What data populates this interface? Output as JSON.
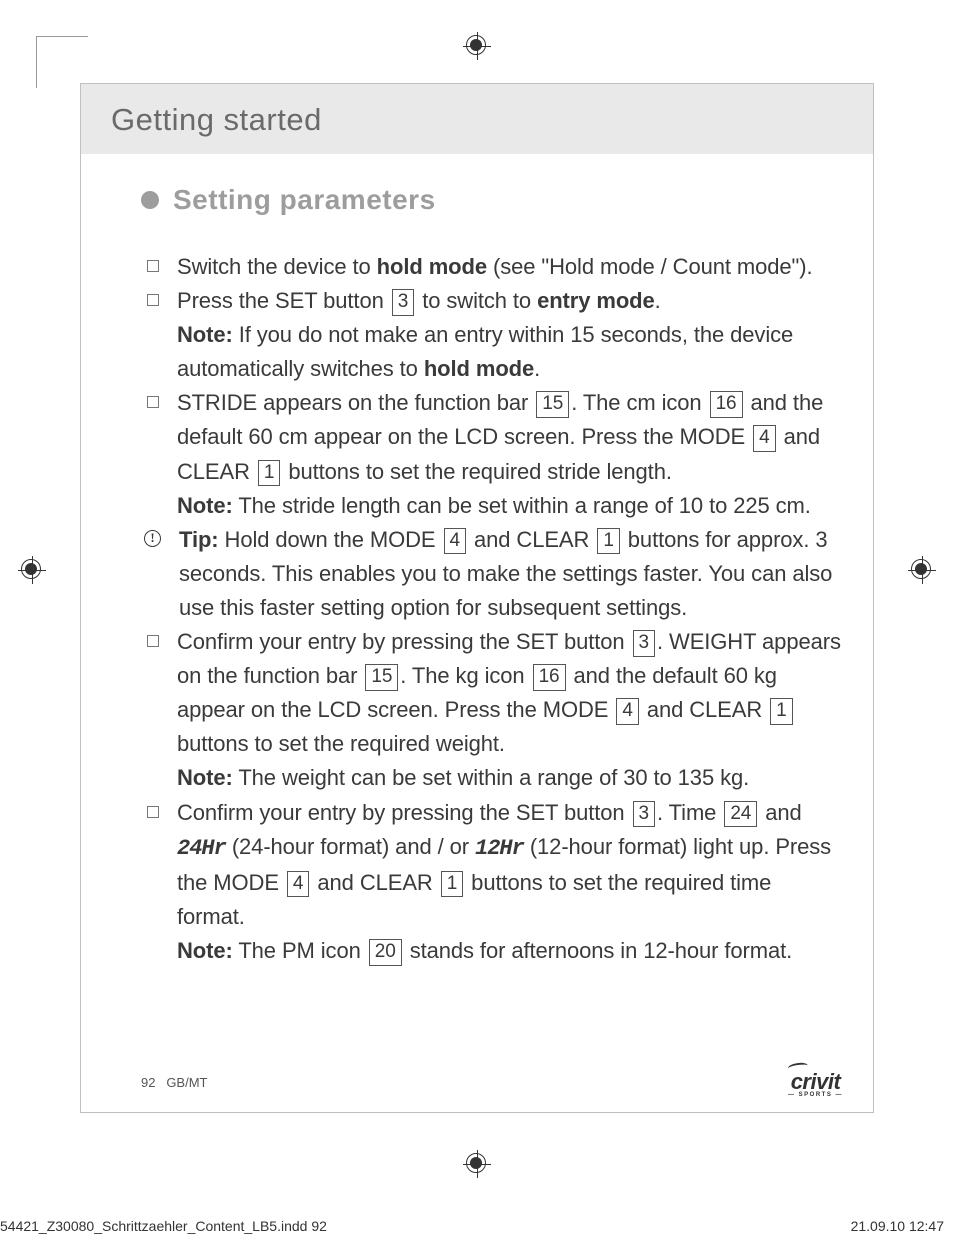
{
  "header": "Getting started",
  "section_title": "Setting parameters",
  "items": [
    {
      "marker": "checkbox",
      "segments": [
        {
          "t": "Switch the device to "
        },
        {
          "t": "hold mode",
          "bold": true
        },
        {
          "t": " (see \"Hold mode / Count mode\")."
        }
      ]
    },
    {
      "marker": "checkbox",
      "segments": [
        {
          "t": "Press the SET button "
        },
        {
          "num": "3"
        },
        {
          "t": " to switch to "
        },
        {
          "t": "entry mode",
          "bold": true
        },
        {
          "t": "."
        },
        {
          "br": true
        },
        {
          "t": "Note:",
          "bold": true
        },
        {
          "t": " If you do not make an entry within 15 seconds, the device automatically switches to "
        },
        {
          "t": "hold mode",
          "bold": true
        },
        {
          "t": "."
        }
      ]
    },
    {
      "marker": "checkbox",
      "segments": [
        {
          "t": "STRIDE appears on the function bar "
        },
        {
          "num": "15"
        },
        {
          "t": ". The cm icon "
        },
        {
          "num": "16"
        },
        {
          "t": " and the default 60 cm appear on the LCD screen. Press the MODE "
        },
        {
          "num": "4"
        },
        {
          "t": " and CLEAR "
        },
        {
          "num": "1"
        },
        {
          "t": " buttons to set the required stride length."
        },
        {
          "br": true
        },
        {
          "t": "Note:",
          "bold": true
        },
        {
          "t": " The stride length can be set within a range of 10 to 225 cm."
        }
      ]
    },
    {
      "marker": "info",
      "segments": [
        {
          "t": "Tip:",
          "bold": true
        },
        {
          "t": " Hold down the MODE "
        },
        {
          "num": "4"
        },
        {
          "t": " and CLEAR "
        },
        {
          "num": "1"
        },
        {
          "t": " buttons for approx. 3 seconds. This enables you to make the settings faster. You can also use this faster setting option for subsequent settings."
        }
      ]
    },
    {
      "marker": "checkbox",
      "segments": [
        {
          "t": "Confirm your entry by pressing the SET button "
        },
        {
          "num": "3"
        },
        {
          "t": ". WEIGHT appears on the function bar "
        },
        {
          "num": "15"
        },
        {
          "t": ". The kg icon "
        },
        {
          "num": "16"
        },
        {
          "t": " and the default 60 kg appear on the LCD screen. Press the MODE "
        },
        {
          "num": "4"
        },
        {
          "t": " and CLEAR "
        },
        {
          "num": "1"
        },
        {
          "t": " buttons to set the required weight."
        },
        {
          "br": true
        },
        {
          "t": "Note:",
          "bold": true
        },
        {
          "t": " The weight can be set within a range of 30 to 135 kg."
        }
      ]
    },
    {
      "marker": "checkbox",
      "segments": [
        {
          "t": "Confirm your entry by pressing the SET button "
        },
        {
          "num": "3"
        },
        {
          "t": ". Time "
        },
        {
          "num": "24"
        },
        {
          "t": " and "
        },
        {
          "t": "24Hr",
          "lcd": true
        },
        {
          "t": " (24-hour format) and / or "
        },
        {
          "t": "12Hr",
          "lcd": true
        },
        {
          "t": " (12-hour format) light up. Press the MODE "
        },
        {
          "num": "4"
        },
        {
          "t": " and CLEAR "
        },
        {
          "num": "1"
        },
        {
          "t": " buttons to set the required time format."
        },
        {
          "br": true
        },
        {
          "t": "Note:",
          "bold": true
        },
        {
          "t": " The PM icon "
        },
        {
          "num": "20"
        },
        {
          "t": " stands for afternoons in 12-hour format."
        }
      ]
    }
  ],
  "footer": {
    "page_num": "92",
    "lang": "GB/MT"
  },
  "brand": {
    "name": "crivit",
    "sub": "— SPORTS —"
  },
  "imprint": {
    "file": "54421_Z30080_Schrittzaehler_Content_LB5.indd   92",
    "datetime": "21.09.10   12:47"
  }
}
